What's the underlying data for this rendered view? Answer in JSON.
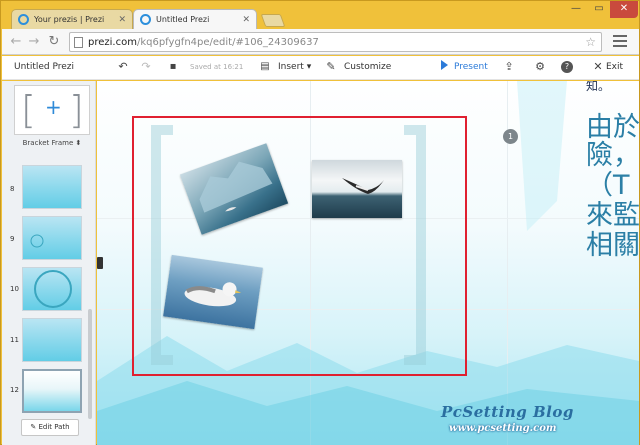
{
  "browser": {
    "tabs": [
      {
        "label": "Your prezis | Prezi",
        "active": false
      },
      {
        "label": "Untitled Prezi",
        "active": true
      }
    ],
    "url_host": "prezi.com",
    "url_path": "/kq6pfygfn4pe/edit/#106_24309637",
    "window_controls": {
      "minimize": "—",
      "maximize": "▭",
      "close": "✕"
    }
  },
  "toolbar": {
    "title": "Untitled Prezi",
    "saved": "Saved at 16:21",
    "insert_label": "Insert",
    "customize_label": "Customize",
    "present_label": "Present",
    "exit_label": "Exit",
    "accent_color": "#2c7bd9"
  },
  "sidebar": {
    "frame_label": "Bracket Frame",
    "slides": [
      {
        "num": "8"
      },
      {
        "num": "9"
      },
      {
        "num": "10"
      },
      {
        "num": "11"
      },
      {
        "num": "12"
      }
    ],
    "edit_path_label": "Edit Path"
  },
  "canvas": {
    "path_marker": "1",
    "text_lines": [
      "由於",
      "險，",
      "（T",
      "來監",
      "相關"
    ],
    "top_fragment": "知。",
    "highlight_color": "#e02030"
  },
  "watermark": {
    "title": "PcSetting Blog",
    "url": "www.pcsetting.com"
  }
}
